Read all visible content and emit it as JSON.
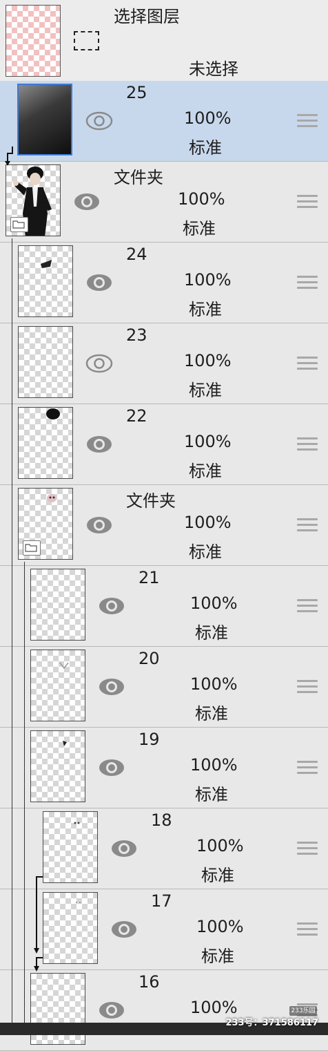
{
  "selection": {
    "title": "选择图层",
    "status": "未选择"
  },
  "layers": [
    {
      "name": "25",
      "opacity": "100%",
      "blend": "标准",
      "visible": true,
      "selected": true
    },
    {
      "name": "文件夹",
      "opacity": "100%",
      "blend": "标准",
      "visible": true,
      "folder": true
    },
    {
      "name": "24",
      "opacity": "100%",
      "blend": "标准",
      "visible": true
    },
    {
      "name": "23",
      "opacity": "100%",
      "blend": "标准",
      "visible": false
    },
    {
      "name": "22",
      "opacity": "100%",
      "blend": "标准",
      "visible": true
    },
    {
      "name": "文件夹",
      "opacity": "100%",
      "blend": "标准",
      "visible": true,
      "folder": true
    },
    {
      "name": "21",
      "opacity": "100%",
      "blend": "标准",
      "visible": true
    },
    {
      "name": "20",
      "opacity": "100%",
      "blend": "标准",
      "visible": true
    },
    {
      "name": "19",
      "opacity": "100%",
      "blend": "标准",
      "visible": true
    },
    {
      "name": "18",
      "opacity": "100%",
      "blend": "标准",
      "visible": true
    },
    {
      "name": "17",
      "opacity": "100%",
      "blend": "标准",
      "visible": true
    },
    {
      "name": "16",
      "opacity": "100%",
      "blend": "标准",
      "visible": true
    }
  ],
  "watermark": {
    "badge": "233乐园",
    "text": "233号：371586117"
  },
  "icons": {
    "visibility": "eye-icon",
    "reorder": "drag-handle-icon",
    "folder": "folder-icon",
    "clipping": "clip-arrow-icon"
  }
}
